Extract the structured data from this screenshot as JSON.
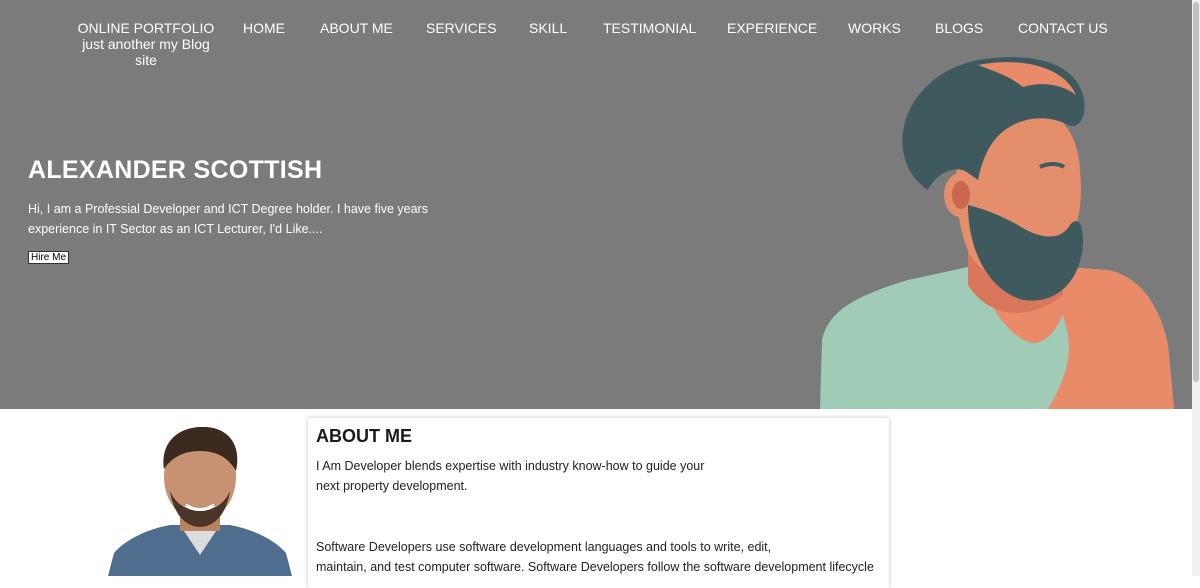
{
  "brand": {
    "title": "ONLINE PORTFOLIO",
    "tagline": "just another my Blog site"
  },
  "nav": [
    "HOME",
    "ABOUT ME",
    "SERVICES",
    "SKILL",
    "TESTIMONIAL",
    "EXPERIENCE",
    "WORKS",
    "BLOGS",
    "CONTACT US"
  ],
  "hero": {
    "name": "ALEXANDER SCOTTISH",
    "intro": "Hi, I am a Professial Developer and ICT Degree holder. I have five years experience in IT Sector as an ICT Lecturer, I'd Like....",
    "button": "Hire Me",
    "background": "#7b7b7b"
  },
  "about": {
    "title": "ABOUT ME",
    "p1_line1": "I Am Developer blends expertise with industry know-how to guide your",
    "p1_line2": "next property development.",
    "p2_line1": "Software Developers use software development languages and tools to write, edit,",
    "p2_line2": "maintain, and test computer software. Software Developers follow the software development lifecycle"
  }
}
